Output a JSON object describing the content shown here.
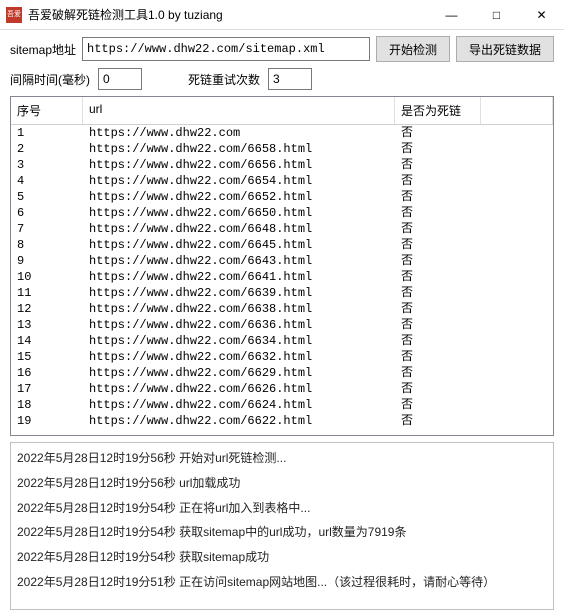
{
  "window": {
    "title": "吾爱破解死链检测工具1.0 by tuziang",
    "icon_text": "吾爱"
  },
  "toolbar": {
    "sitemap_label": "sitemap地址",
    "sitemap_value": "https://www.dhw22.com/sitemap.xml",
    "start_button": "开始检测",
    "export_button": "导出死链数据",
    "interval_label": "间隔时间(毫秒)",
    "interval_value": "0",
    "retry_label": "死链重试次数",
    "retry_value": "3"
  },
  "table": {
    "headers": {
      "index": "序号",
      "url": "url",
      "dead": "是否为死链"
    },
    "rows": [
      {
        "i": "1",
        "url": "https://www.dhw22.com",
        "dead": "否"
      },
      {
        "i": "2",
        "url": "https://www.dhw22.com/6658.html",
        "dead": "否"
      },
      {
        "i": "3",
        "url": "https://www.dhw22.com/6656.html",
        "dead": "否"
      },
      {
        "i": "4",
        "url": "https://www.dhw22.com/6654.html",
        "dead": "否"
      },
      {
        "i": "5",
        "url": "https://www.dhw22.com/6652.html",
        "dead": "否"
      },
      {
        "i": "6",
        "url": "https://www.dhw22.com/6650.html",
        "dead": "否"
      },
      {
        "i": "7",
        "url": "https://www.dhw22.com/6648.html",
        "dead": "否"
      },
      {
        "i": "8",
        "url": "https://www.dhw22.com/6645.html",
        "dead": "否"
      },
      {
        "i": "9",
        "url": "https://www.dhw22.com/6643.html",
        "dead": "否"
      },
      {
        "i": "10",
        "url": "https://www.dhw22.com/6641.html",
        "dead": "否"
      },
      {
        "i": "11",
        "url": "https://www.dhw22.com/6639.html",
        "dead": "否"
      },
      {
        "i": "12",
        "url": "https://www.dhw22.com/6638.html",
        "dead": "否"
      },
      {
        "i": "13",
        "url": "https://www.dhw22.com/6636.html",
        "dead": "否"
      },
      {
        "i": "14",
        "url": "https://www.dhw22.com/6634.html",
        "dead": "否"
      },
      {
        "i": "15",
        "url": "https://www.dhw22.com/6632.html",
        "dead": "否"
      },
      {
        "i": "16",
        "url": "https://www.dhw22.com/6629.html",
        "dead": "否"
      },
      {
        "i": "17",
        "url": "https://www.dhw22.com/6626.html",
        "dead": "否"
      },
      {
        "i": "18",
        "url": "https://www.dhw22.com/6624.html",
        "dead": "否"
      },
      {
        "i": "19",
        "url": "https://www.dhw22.com/6622.html",
        "dead": "否"
      }
    ]
  },
  "log": [
    "2022年5月28日12时19分56秒    开始对url死链检测...",
    "2022年5月28日12时19分56秒    url加载成功",
    "2022年5月28日12时19分54秒    正在将url加入到表格中...",
    "2022年5月28日12时19分54秒    获取sitemap中的url成功，url数量为7919条",
    "2022年5月28日12时19分54秒    获取sitemap成功",
    "2022年5月28日12时19分51秒    正在访问sitemap网站地图...（该过程很耗时，请耐心等待）"
  ]
}
